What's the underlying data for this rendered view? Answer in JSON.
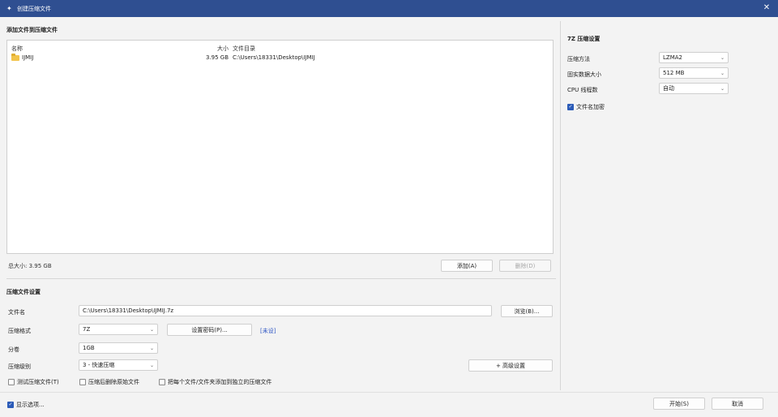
{
  "window": {
    "title": "创建压缩文件",
    "close_glyph": "✕"
  },
  "add_section": {
    "title": "添加文件到压缩文件",
    "columns": {
      "name": "名称",
      "size": "大小",
      "path": "文件目录"
    },
    "rows": [
      {
        "name": "IJMIJ",
        "size": "3.95 GB",
        "path": "C:\\Users\\18331\\Desktop\\IJMIJ",
        "icon": "folder-icon"
      }
    ],
    "total": "总大小: 3.95 GB",
    "add_button": "添加(A)",
    "delete_button": "删除(D)"
  },
  "archive_settings": {
    "title": "压缩文件设置",
    "filename_label": "文件名",
    "filename_value": "C:\\Users\\18331\\Desktop\\IJMIJ.7z",
    "browse_button": "浏览(B)...",
    "format_label": "压缩格式",
    "format_value": "7Z",
    "password_button": "设置密码(P)...",
    "password_link": "[未设]",
    "volume_label": "分卷",
    "volume_value": "1GB",
    "level_label": "压缩级别",
    "level_value": "3 - 快速压缩",
    "advanced_button": "+ 高级设置",
    "options": [
      {
        "label": "测试压缩文件(T)",
        "checked": false
      },
      {
        "label": "压缩后删除原始文件",
        "checked": false
      },
      {
        "label": "把每个文件/文件夹添加到独立的压缩文件",
        "checked": false
      }
    ]
  },
  "sevenzip_settings": {
    "title": "7Z 压缩设置",
    "method_label": "压缩方法",
    "method_value": "LZMA2",
    "dict_label": "固实数据大小",
    "dict_value": "512 MB",
    "cpu_label": "CPU 线程数",
    "cpu_value": "自动",
    "encrypt_label": "文件名加密",
    "encrypt_checked": true
  },
  "footer": {
    "more_options": "显示选项...",
    "more_options_checked": true,
    "start_button": "开始(S)",
    "cancel_button": "取消"
  },
  "colors": {
    "titlebar": "#2f4f91",
    "accent": "#2b5bb8",
    "link": "#2d55c4"
  }
}
